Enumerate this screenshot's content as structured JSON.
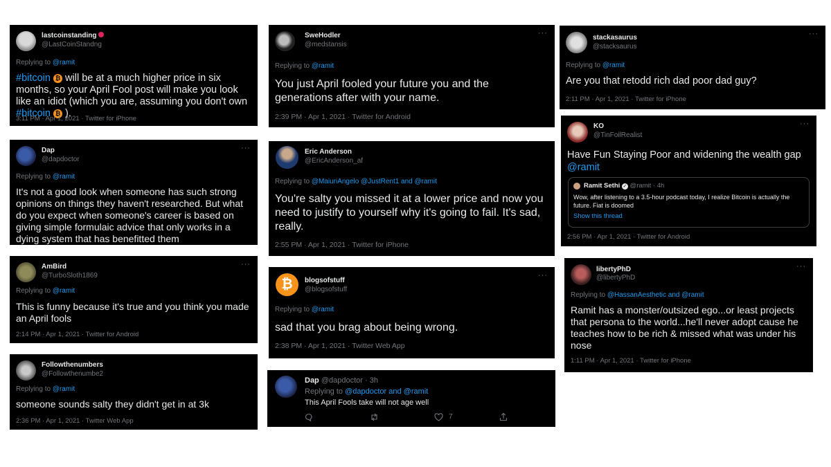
{
  "common": {
    "replying_to": "Replying to",
    "menu_dots": "···"
  },
  "tweets": [
    {
      "name": "lastcoinstanding",
      "handle": "@LastCoinStandng",
      "replying": "@ramit",
      "text_1": "#bitcoin",
      "text_2": " will be at a much higher price in six months, so your April Fool post will make you look like an idiot (which you are, assuming you don't own ",
      "text_3": "#bitcoin",
      "text_4": " ).",
      "meta": "3:11 PM · Apr 1, 2021 · Twitter for iPhone"
    },
    {
      "name": "Dap",
      "handle": "@dapdoctor",
      "replying": "@ramit",
      "text": "It's not a good look when someone has such strong opinions on things they haven't researched. But what do you expect when someone's career is based on giving simple formulaic advice that only works in a dying system that has benefitted them"
    },
    {
      "name": "AmBird",
      "handle": "@TurboSloth1869",
      "replying": "@ramit",
      "text": "This is funny because it's true and you think you made an April fools",
      "meta": "2:14 PM · Apr 1, 2021 · Twitter for Android"
    },
    {
      "name": "Followthenumbers",
      "handle": "@Followthenumbe2",
      "replying": "@ramit",
      "text": "someone sounds salty they didn't get in at 3k",
      "meta": "2:36 PM · Apr 1, 2021 · Twitter Web App"
    },
    {
      "name": "SweHodler",
      "handle": "@medstansis",
      "replying": "@ramit",
      "text": "You just April fooled your future you and the generations after with your name.",
      "meta": "2:39 PM · Apr 1, 2021 · Twitter for Android"
    },
    {
      "name": "Eric Anderson",
      "handle": "@EricAnderson_af",
      "replying": "@MaiuriAngelo @JustRent1 and @ramit",
      "text": "You're salty you missed it at a lower price and now you need to justify to yourself why it's going to fail. It's sad, really.",
      "meta": "2:55 PM · Apr 1, 2021 · Twitter for iPhone"
    },
    {
      "name": "blogsofstuff",
      "handle": "@blogsofstuff",
      "replying": "@ramit",
      "text": "sad that you brag about being wrong.",
      "meta": "2:38 PM · Apr 1, 2021 · Twitter Web App"
    },
    {
      "name": "Dap",
      "handle": "@dapdoctor",
      "time": "· 3h",
      "replying": "@dapdoctor and @ramit",
      "text": "This April Fools take will not age well",
      "like_count": "7"
    },
    {
      "name": "stackasaurus",
      "handle": "@stacksaurus",
      "replying": "@ramit",
      "text": "Are you that retodd rich dad poor dad guy?",
      "meta": "2:11 PM · Apr 1, 2021 · Twitter for iPhone"
    },
    {
      "name": "KO",
      "handle": "@TinFoilRealist",
      "text": "Have Fun Staying Poor and widening the wealth gap",
      "mention": "@ramit",
      "quote": {
        "name": "Ramit Sethi",
        "handle": "@ramit · 4h",
        "text": "Wow, after listening to a 3.5-hour podcast today, I realize Bitcoin is actually the future. Fiat is doomed",
        "link": "Show this thread"
      },
      "meta": "2:56 PM · Apr 1, 2021 · Twitter for Android"
    },
    {
      "name": "libertyPhD",
      "handle": "@libertyPhD",
      "replying": "@HassanAesthetic and @ramit",
      "text": "Ramit has a monster/outsized ego...or least projects that persona to the world...he'll never adopt cause he teaches how to be rich & missed what was under his nose",
      "meta": "1:11 PM · Apr 1, 2021 · Twitter for iPhone"
    }
  ],
  "colors": {
    "card_bg": "#000000",
    "link": "#1d9bf0",
    "muted": "#71767b",
    "text": "#e7e9ea",
    "bitcoin": "#f7931a"
  }
}
